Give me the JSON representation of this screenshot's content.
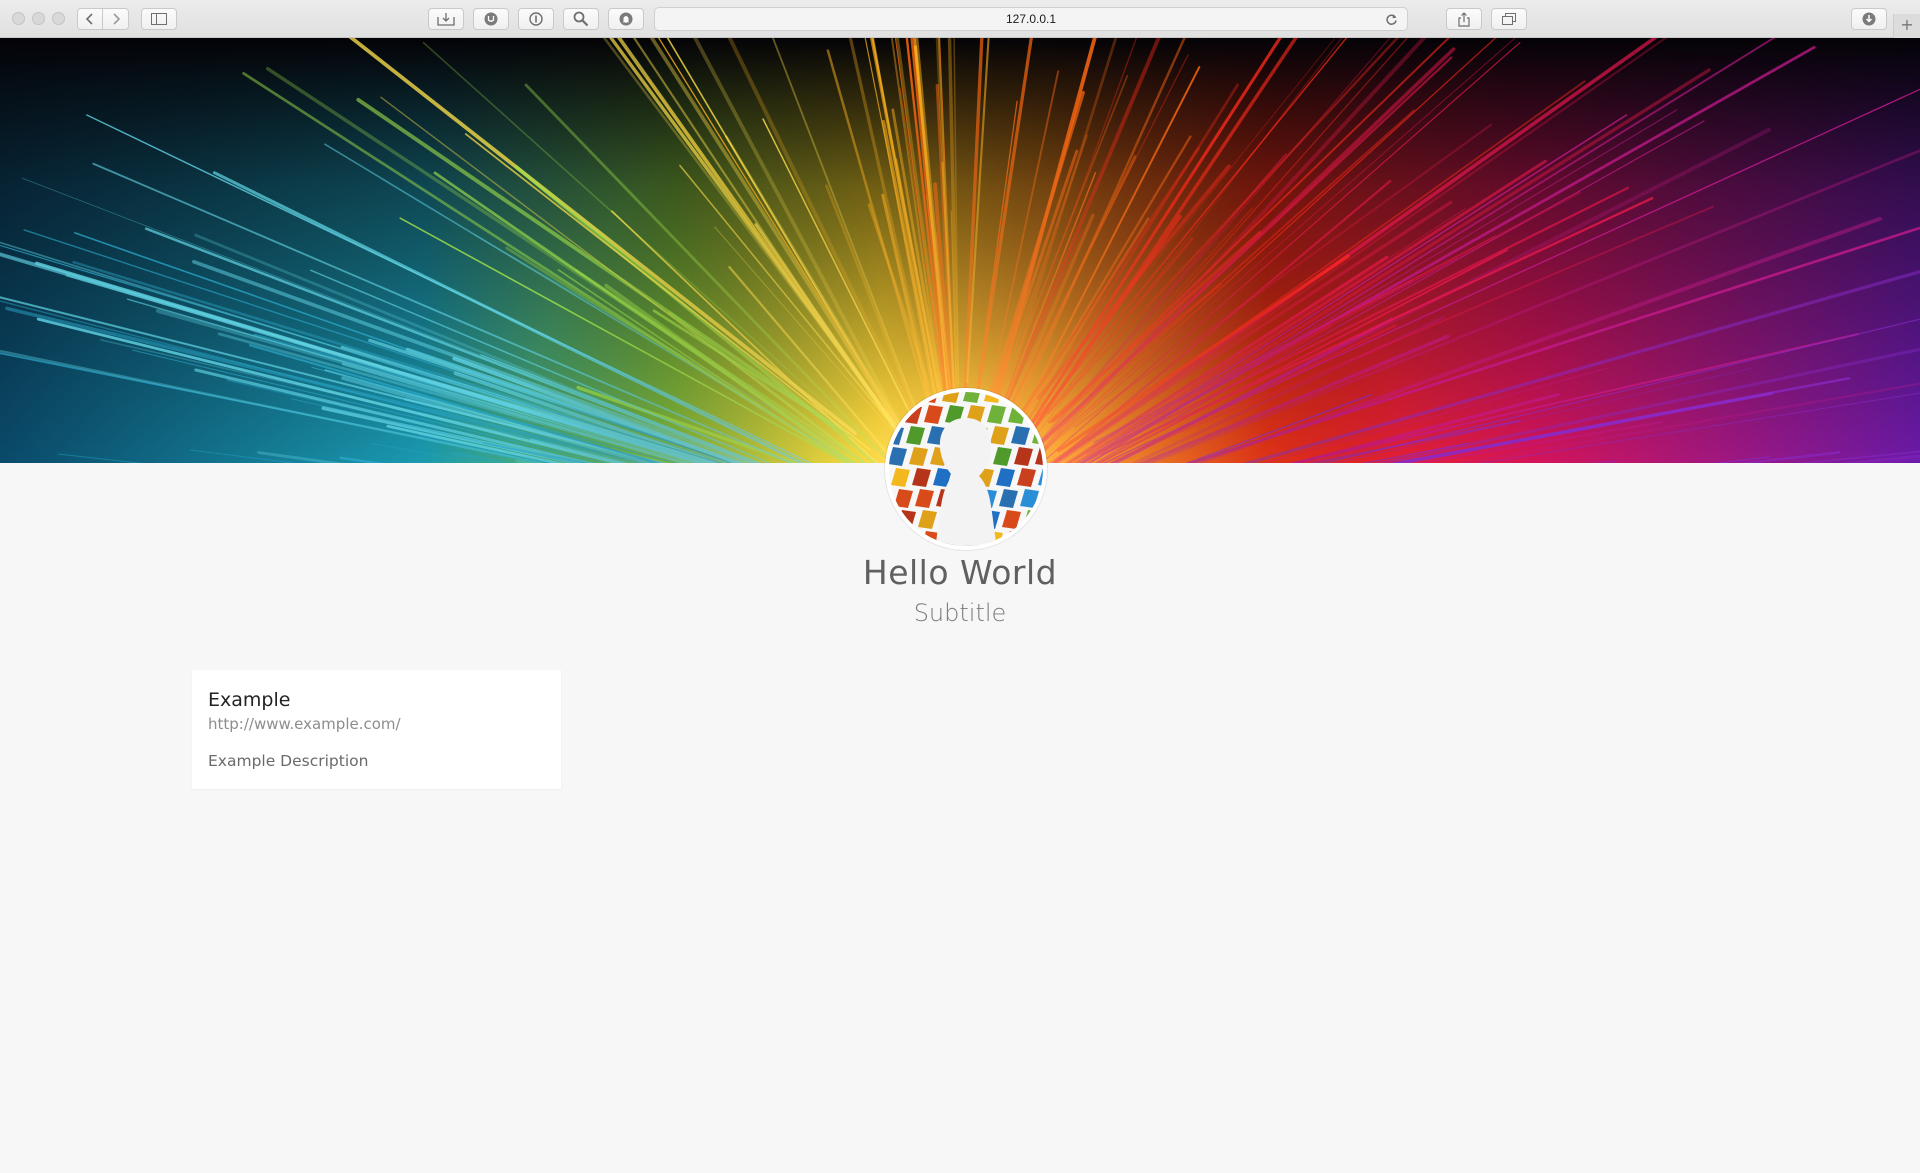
{
  "browser": {
    "url": "127.0.0.1",
    "new_tab_glyph": "+",
    "icons": {
      "back": "chevron-left-icon",
      "forward": "chevron-right-icon",
      "sidebar": "sidebar-icon",
      "reload": "reload-icon",
      "share": "share-icon",
      "tabs": "tabs-overview-icon",
      "downloads": "download-icon"
    }
  },
  "profile": {
    "name": "Hello World",
    "subtitle": "Subtitle"
  },
  "links": [
    {
      "title": "Example",
      "url": "http://www.example.com/",
      "description": "Example Description"
    }
  ],
  "colors": {
    "page_background": "#f7f7f7",
    "card_background": "#ffffff",
    "name_text": "#606060",
    "subtitle_text": "#7a7a7a"
  }
}
